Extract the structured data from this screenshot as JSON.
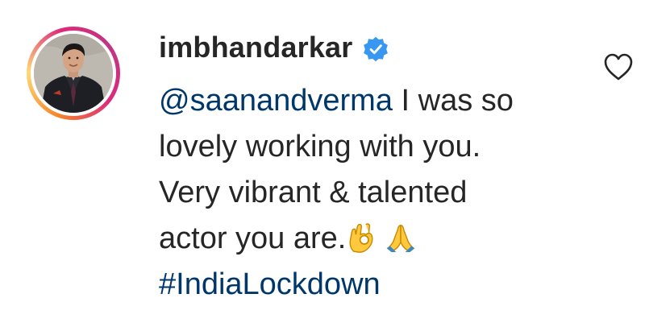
{
  "comment": {
    "username": "imbhandarkar",
    "verified": true,
    "mention": "@saanandverma",
    "text_line1_rest": " I was so",
    "text_line2": "lovely working with you.",
    "text_line3": "Very vibrant & talented",
    "text_line4": "actor you are.",
    "emojis": [
      "ok-hand-emoji",
      "folded-hands-emoji"
    ],
    "hashtag": "#IndiaLockdown"
  },
  "colors": {
    "link": "#00376b",
    "verified_badge": "#3897f0",
    "text": "#262626"
  },
  "icons": {
    "like": "heart-outline-icon",
    "verified": "verified-badge-icon"
  }
}
